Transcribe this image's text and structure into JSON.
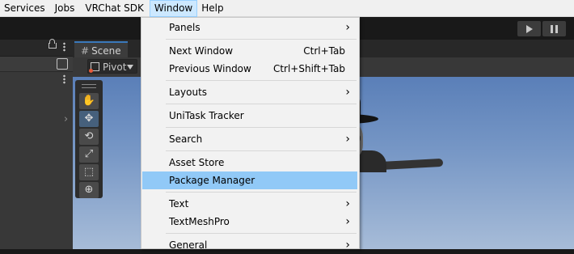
{
  "menubar": {
    "items": [
      {
        "label": "Services"
      },
      {
        "label": "Jobs"
      },
      {
        "label": "VRChat SDK"
      },
      {
        "label": "Window",
        "active": true
      },
      {
        "label": "Help"
      }
    ]
  },
  "scene": {
    "tab_label": "Scene",
    "pivot_label": "Pivot"
  },
  "window_menu": {
    "items": [
      {
        "label": "Panels",
        "submenu": true
      },
      {
        "label": "Next Window",
        "shortcut": "Ctrl+Tab"
      },
      {
        "label": "Previous Window",
        "shortcut": "Ctrl+Shift+Tab"
      },
      {
        "label": "Layouts",
        "submenu": true
      },
      {
        "label": "UniTask Tracker"
      },
      {
        "label": "Search",
        "submenu": true
      },
      {
        "label": "Asset Store"
      },
      {
        "label": "Package Manager",
        "highlighted": true
      },
      {
        "label": "Text",
        "submenu": true
      },
      {
        "label": "TextMeshPro",
        "submenu": true
      },
      {
        "label": "General",
        "submenu": true
      }
    ],
    "submenu_arrow": "›"
  },
  "tools": {
    "icons": [
      "hand-icon",
      "move-icon",
      "rotate-icon",
      "scale-icon",
      "rect-icon",
      "transform-icon"
    ],
    "glyphs": [
      "✋",
      "✥",
      "⟲",
      "⤢",
      "⬚",
      "⊕"
    ]
  },
  "colors": {
    "menu_highlight": "#91c9f7",
    "active_menubar_item": "#cce8ff",
    "editor_dark": "#191919",
    "sky_top": "#5a7fb8"
  }
}
